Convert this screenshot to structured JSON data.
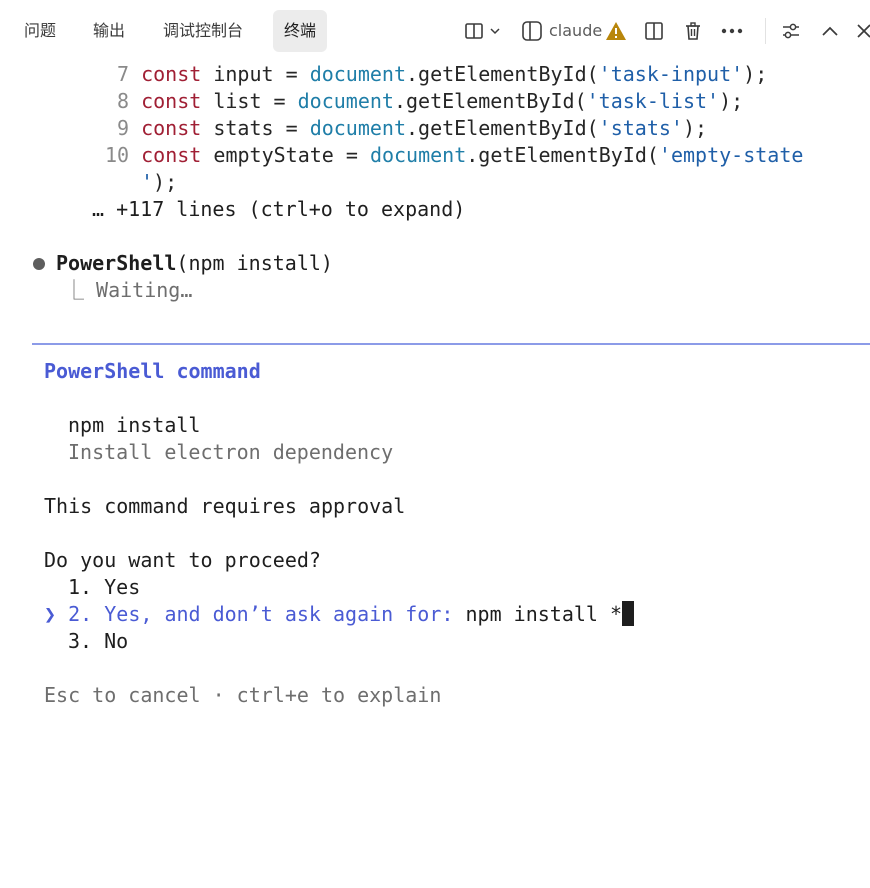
{
  "header": {
    "tabs": [
      {
        "label": "问题",
        "active": false
      },
      {
        "label": "输出",
        "active": false
      },
      {
        "label": "调试控制台",
        "active": false
      },
      {
        "label": "终端",
        "active": true
      }
    ],
    "terminal_name": "claude",
    "warning_color": "#b8860b",
    "icons": [
      "split-layout-icon",
      "chevron-down-icon",
      "terminal-panel-icon",
      "warning-icon",
      "split-terminal-icon",
      "trash-icon",
      "more-icon",
      "settings-sliders-icon",
      "chevron-up-icon",
      "close-icon"
    ]
  },
  "code": {
    "lines": [
      {
        "num": "7",
        "kw": "const",
        "name": " input = ",
        "obj": "document",
        "method": ".getElementById(",
        "str": "'task-input'",
        "end": ");"
      },
      {
        "num": "8",
        "kw": "const",
        "name": " list = ",
        "obj": "document",
        "method": ".getElementById(",
        "str": "'task-list'",
        "end": ");"
      },
      {
        "num": "9",
        "kw": "const",
        "name": " stats = ",
        "obj": "document",
        "method": ".getElementById(",
        "str": "'stats'",
        "end": ");"
      },
      {
        "num": "10",
        "kw": "const",
        "name": " emptyState = ",
        "obj": "document",
        "method": ".getElementById(",
        "str": "'empty-state",
        "end": ""
      }
    ],
    "wrap_str": "'",
    "wrap_end": ");",
    "collapsed": "… +117 lines (ctrl+o to expand)"
  },
  "tool": {
    "name": "PowerShell",
    "args": "(npm install)",
    "status_prefix": "⎿ ",
    "status": "Waiting…"
  },
  "prompt": {
    "title": "PowerShell command",
    "command": "npm install",
    "description": "Install electron dependency",
    "notice": "This command requires approval",
    "question": "Do you want to proceed?",
    "options": [
      {
        "num": "1.",
        "label": "Yes"
      },
      {
        "num": "2.",
        "label": "Yes, and don’t ask again for:",
        "value": "npm install *"
      },
      {
        "num": "3.",
        "label": "No"
      }
    ],
    "selector": "❯",
    "footer": "Esc to cancel · ctrl+e to explain",
    "accent": "#4a5bd4"
  }
}
